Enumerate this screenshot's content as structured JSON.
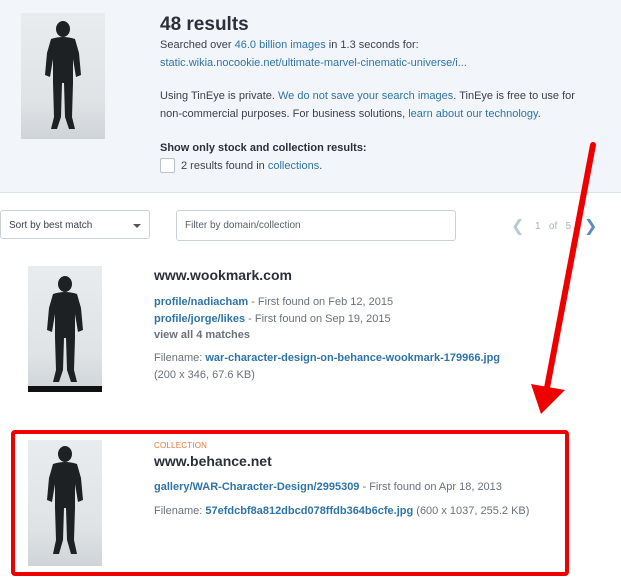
{
  "summary": {
    "title": "48 results",
    "searched_prefix": "Searched over ",
    "searched_count": "46.0 billion images",
    "searched_suffix": " in 1.3 seconds for:",
    "query_url": "static.wikia.nocookie.net/ultimate-marvel-cinematic-universe/i...",
    "privacy_prefix": "Using TinEye is private. ",
    "privacy_link": "We do not save your search images",
    "privacy_suffix": ". TinEye is free to use for",
    "privacy_line2_prefix": "non-commercial purposes. For business solutions, ",
    "privacy_line2_link": "learn about our technology",
    "privacy_line2_suffix": ".",
    "stock_heading": "Show only stock and collection results:",
    "stock_count": "2 results found in ",
    "stock_link": "collections",
    "stock_suffix": "."
  },
  "controls": {
    "sort_label": "Sort by best match",
    "filter_placeholder": "Filter by domain/collection",
    "pager_current": "1",
    "pager_of": "of",
    "pager_total": "5",
    "prev_glyph": "❮",
    "next_glyph": "❯"
  },
  "results": [
    {
      "domain": "www.wookmark.com",
      "matches": [
        {
          "path": "profile/nadiacham",
          "found": " - First found on Feb 12, 2015"
        },
        {
          "path": "profile/jorge/likes",
          "found": " - First found on Sep 19, 2015"
        }
      ],
      "view_all": "view all 4 matches",
      "filename_label": "Filename: ",
      "filename": "war-character-design-on-behance-wookmark-179966.jpg",
      "dims": "(200 x 346, 67.6 KB)"
    },
    {
      "badge": "COLLECTION",
      "domain": "www.behance.net",
      "match_path": "gallery/WAR-Character-Design/2995309",
      "match_found": " - First found on Apr 18, 2013",
      "filename_label": "Filename: ",
      "filename": "57efdcbf8a812dbcd078ffdb364b6cfe.jpg",
      "dims": " (600 x 1037, 255.2 KB)"
    }
  ],
  "colors": {
    "link": "#2f74a8",
    "highlight": "#ee0000",
    "collection_badge": "#e07a3a"
  }
}
